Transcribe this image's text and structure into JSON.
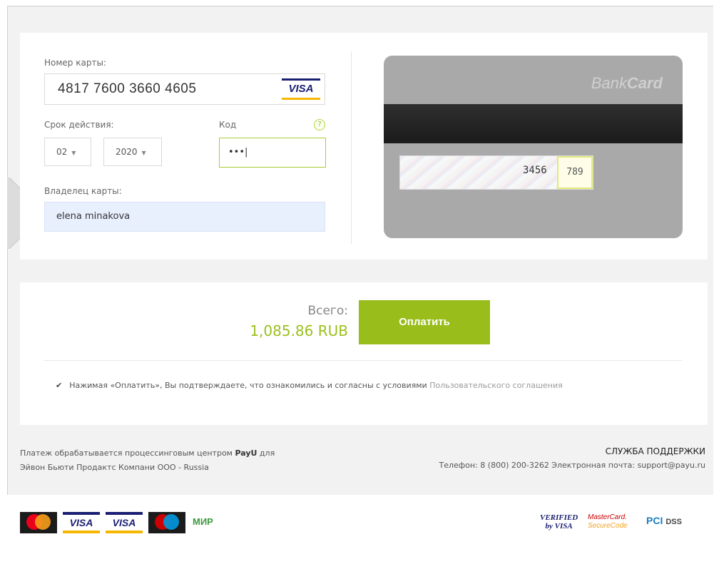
{
  "form": {
    "card_number_label": "Номер карты:",
    "card_number_value": "4817 7600 3660 4605",
    "card_type": "VISA",
    "expiry_label": "Срок действия:",
    "expiry_month": "02",
    "expiry_year": "2020",
    "cvc_label": "Код",
    "cvc_help": "?",
    "cvc_value": "•••|",
    "holder_label": "Владелец карты:",
    "holder_value": "elena minakova"
  },
  "card_preview": {
    "brand_light": "Bank",
    "brand_bold": "Card",
    "signature_digits": "3456",
    "cvc_digits": "789"
  },
  "payment": {
    "total_label": "Всего:",
    "total_amount": "1,085.86 RUB",
    "pay_button": "Оплатить",
    "agree_text": "Нажимая «Оплатить», Вы подтверждаете, что ознакомились и согласны с условиями ",
    "agree_link": "Пользовательского соглашения",
    "agree_checked": true
  },
  "footer": {
    "processor_prefix": "Платеж обрабатывается процессинговым центром ",
    "processor_name": "PayU",
    "processor_suffix": " для",
    "merchant": "Эйвон Бьюти Продактс Компани ООО - Russia",
    "support_title": "СЛУЖБА ПОДДЕРЖКИ",
    "support_contacts": "Телефон: 8 (800) 200-3262   Электронная почта: support@payu.ru"
  },
  "logos": {
    "visa1": "VISA",
    "visa2": "VISA",
    "mir": "МИР",
    "verified_line1": "VERIFIED",
    "verified_line2": "by VISA",
    "mcsc_line1": "MasterCard.",
    "mcsc_line2": "SecureCode",
    "pci": "PCI",
    "dss": "DSS"
  },
  "colors": {
    "accent_green": "#99bd1a",
    "amount_green": "#9bc01c",
    "autofill_blue": "#e8f0fe"
  }
}
